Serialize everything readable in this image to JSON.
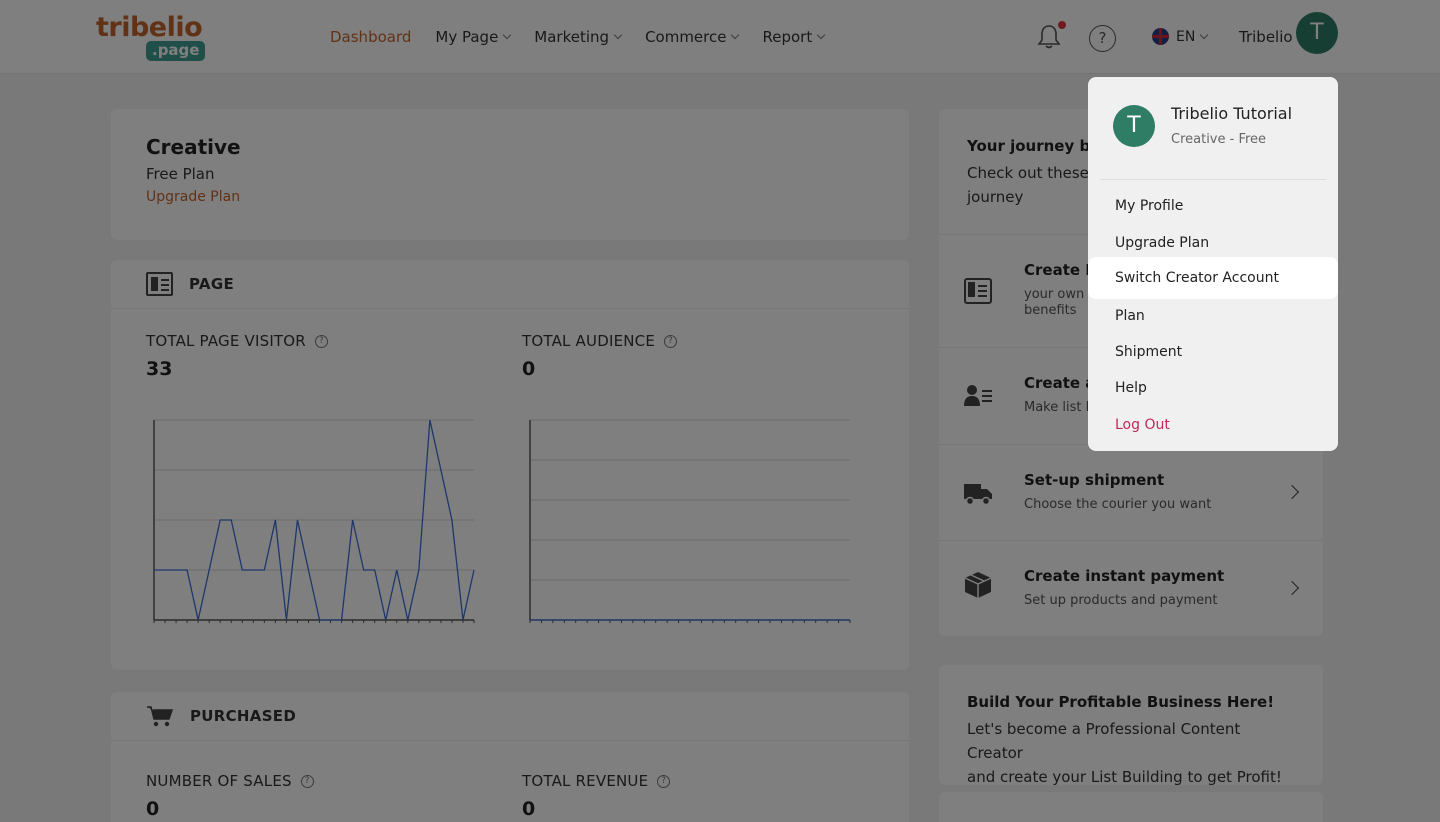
{
  "header": {
    "logo_word": "tribelio",
    "logo_pill": ".page",
    "nav": [
      {
        "label": "Dashboard",
        "active": true
      },
      {
        "label": "My Page",
        "active": false
      },
      {
        "label": "Marketing",
        "active": false
      },
      {
        "label": "Commerce",
        "active": false
      },
      {
        "label": "Report",
        "active": false
      }
    ],
    "help_glyph": "?",
    "language": "EN",
    "user_name": "Tribelio",
    "avatar_initial": "T"
  },
  "plan_card": {
    "title": "Creative",
    "plan": "Free Plan",
    "upgrade_link": "Upgrade Plan"
  },
  "page_section": {
    "title": "PAGE",
    "visitor_label": "TOTAL PAGE VISITOR",
    "visitor_value": "33",
    "audience_label": "TOTAL AUDIENCE",
    "audience_value": "0"
  },
  "chart_data": [
    {
      "type": "line",
      "ylim": [
        0,
        4
      ],
      "grid": true,
      "x": [
        1,
        2,
        3,
        4,
        5,
        6,
        7,
        8,
        9,
        10,
        11,
        12,
        13,
        14,
        15,
        16,
        17,
        18,
        19,
        20,
        21,
        22,
        23,
        24,
        25,
        26,
        27,
        28,
        29
      ],
      "values": [
        1,
        1,
        1,
        1,
        0,
        1,
        2,
        2,
        1,
        1,
        1,
        2,
        0,
        2,
        1,
        0,
        0,
        0,
        2,
        1,
        1,
        0,
        1,
        0,
        1,
        4,
        3,
        2,
        0,
        1
      ]
    },
    {
      "type": "line",
      "ylim": [
        0,
        5
      ],
      "grid": true,
      "x": [
        1,
        2,
        3,
        4,
        5,
        6,
        7,
        8,
        9,
        10,
        11,
        12,
        13,
        14,
        15,
        16,
        17,
        18,
        19,
        20,
        21,
        22,
        23,
        24,
        25,
        26,
        27,
        28,
        29
      ],
      "values": [
        0,
        0,
        0,
        0,
        0,
        0,
        0,
        0,
        0,
        0,
        0,
        0,
        0,
        0,
        0,
        0,
        0,
        0,
        0,
        0,
        0,
        0,
        0,
        0,
        0,
        0,
        0,
        0,
        0
      ]
    }
  ],
  "purchased_section": {
    "title": "PURCHASED",
    "sales_label": "NUMBER OF SALES",
    "sales_value": "0",
    "revenue_label": "TOTAL REVENUE",
    "revenue_value": "0"
  },
  "journey": {
    "title": "Your journey be",
    "subtitle_line1": "Check out these",
    "subtitle_line2": "journey",
    "items": [
      {
        "title": "Create P",
        "desc_line1": "your own",
        "desc_line2": "benefits"
      },
      {
        "title": "Create a",
        "desc_line1": "Make list l",
        "desc_line2": ""
      },
      {
        "title": "Set-up shipment",
        "desc_line1": "Choose the courier you want",
        "desc_line2": ""
      },
      {
        "title": "Create instant payment",
        "desc_line1": "Set up products and payment",
        "desc_line2": ""
      }
    ]
  },
  "business_card": {
    "title": "Build Your Profitable Business Here!",
    "subtitle_line1": "Let's become a Professional Content Creator",
    "subtitle_line2": "and create your List Building to get Profit!"
  },
  "dropdown": {
    "avatar_initial": "T",
    "name": "Tribelio Tutorial",
    "plan": "Creative - Free",
    "items": [
      {
        "label": "My Profile",
        "highlighted": false
      },
      {
        "label": "Upgrade Plan",
        "highlighted": false
      },
      {
        "label": "Switch Creator Account",
        "highlighted": true
      },
      {
        "label": "Plan",
        "highlighted": false
      },
      {
        "label": "Shipment",
        "highlighted": false
      },
      {
        "label": "Help",
        "highlighted": false
      },
      {
        "label": "Log Out",
        "highlighted": false
      }
    ]
  },
  "colors": {
    "brand_orange": "#c4642d",
    "brand_teal": "#3f9f90",
    "avatar_green": "#2e7d64",
    "chart_line": "#3a6fd8",
    "logout_red": "#c2285a"
  }
}
